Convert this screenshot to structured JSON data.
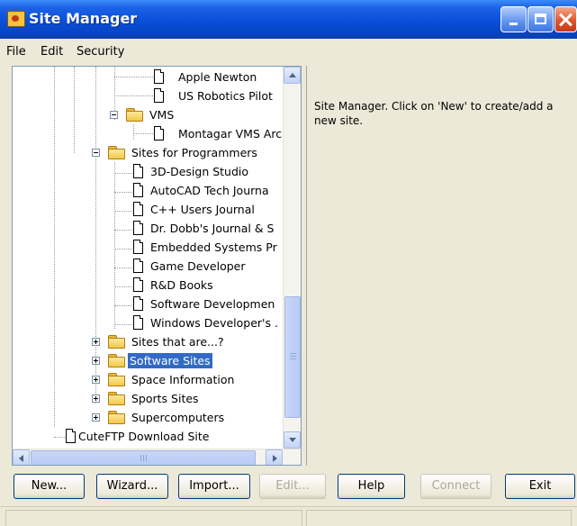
{
  "window": {
    "title": "Site Manager",
    "icon": "site-manager-icon"
  },
  "menu": [
    "File",
    "Edit",
    "Security"
  ],
  "tree": {
    "items": [
      {
        "label": "Apple Newton",
        "type": "doc"
      },
      {
        "label": "US Robotics Pilot",
        "type": "doc"
      },
      {
        "label": "VMS",
        "type": "folder",
        "state": "expanded"
      },
      {
        "label": "Montagar VMS Arc",
        "type": "doc"
      },
      {
        "label": "Sites for Programmers",
        "type": "folder",
        "state": "expanded"
      },
      {
        "label": "3D-Design Studio",
        "type": "doc"
      },
      {
        "label": "AutoCAD Tech Journa",
        "type": "doc"
      },
      {
        "label": "C++ Users Journal",
        "type": "doc"
      },
      {
        "label": "Dr. Dobb's Journal & S",
        "type": "doc"
      },
      {
        "label": "Embedded Systems Pr",
        "type": "doc"
      },
      {
        "label": "Game Developer",
        "type": "doc"
      },
      {
        "label": "R&D Books",
        "type": "doc"
      },
      {
        "label": "Software Developmen",
        "type": "doc"
      },
      {
        "label": "Windows Developer's .",
        "type": "doc"
      },
      {
        "label": "Sites that are...?",
        "type": "folder",
        "state": "collapsed"
      },
      {
        "label": "Software Sites",
        "type": "folder",
        "state": "collapsed",
        "selected": true
      },
      {
        "label": "Space Information",
        "type": "folder",
        "state": "collapsed"
      },
      {
        "label": "Sports Sites",
        "type": "folder",
        "state": "collapsed"
      },
      {
        "label": "Supercomputers",
        "type": "folder",
        "state": "collapsed"
      },
      {
        "label": "CuteFTP Download Site",
        "type": "doc"
      }
    ]
  },
  "info": {
    "text": "Site Manager. Click on 'New' to create/add a new site."
  },
  "buttons": {
    "new": "New...",
    "wizard": "Wizard...",
    "import": "Import...",
    "edit": "Edit...",
    "help": "Help",
    "connect": "Connect",
    "exit": "Exit"
  },
  "colors": {
    "titlebar": "#0a4fd8",
    "selection": "#316AC5",
    "window_bg": "#ECE9D8"
  }
}
